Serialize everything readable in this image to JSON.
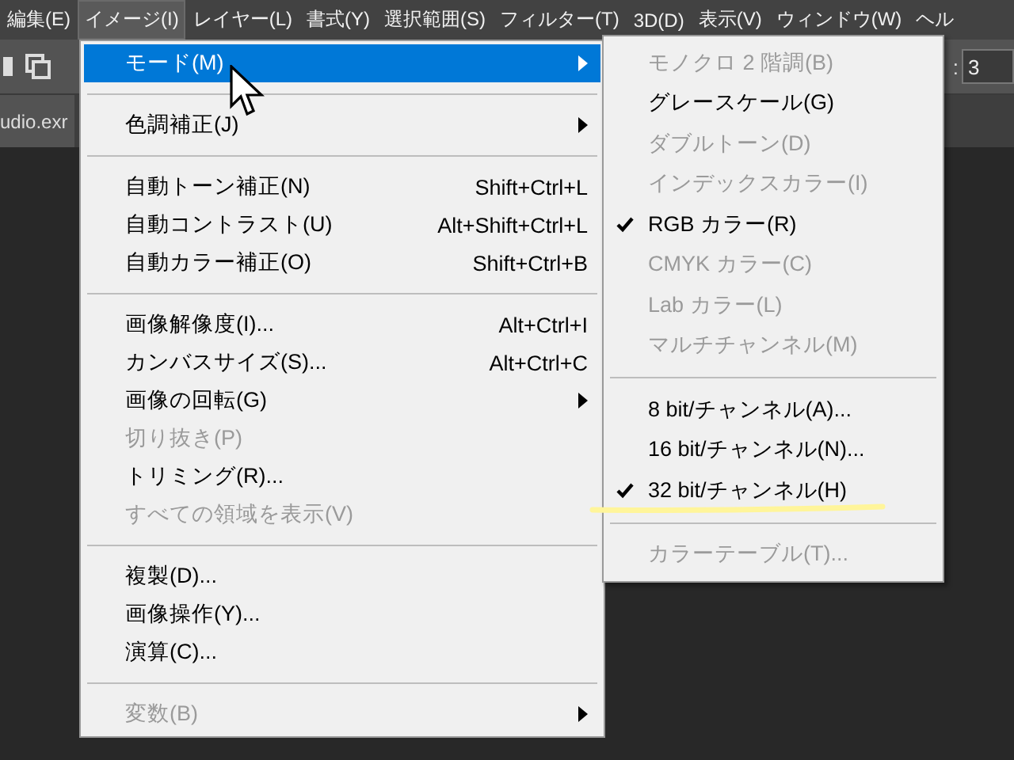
{
  "menubar": [
    {
      "label": "編集(E)",
      "selected": false
    },
    {
      "label": "イメージ(I)",
      "selected": true
    },
    {
      "label": "レイヤー(L)",
      "selected": false
    },
    {
      "label": "書式(Y)",
      "selected": false
    },
    {
      "label": "選択範囲(S)",
      "selected": false
    },
    {
      "label": "フィルター(T)",
      "selected": false
    },
    {
      "label": "3D(D)",
      "selected": false
    },
    {
      "label": "表示(V)",
      "selected": false
    },
    {
      "label": "ウィンドウ(W)",
      "selected": false
    },
    {
      "label": "ヘル",
      "selected": false
    }
  ],
  "toolbar": {
    "field_label": ":",
    "field_value": "3"
  },
  "document_tab": {
    "label": "udio.exr"
  },
  "image_menu": [
    {
      "kind": "item",
      "label": "モード(M)",
      "submenu": true,
      "disabled": false,
      "selected": true
    },
    {
      "kind": "separator"
    },
    {
      "kind": "item",
      "label": "色調補正(J)",
      "submenu": true,
      "disabled": false,
      "selected": false
    },
    {
      "kind": "separator"
    },
    {
      "kind": "item",
      "label": "自動トーン補正(N)",
      "shortcut": "Shift+Ctrl+L",
      "submenu": false,
      "disabled": false,
      "selected": false
    },
    {
      "kind": "item",
      "label": "自動コントラスト(U)",
      "shortcut": "Alt+Shift+Ctrl+L",
      "submenu": false,
      "disabled": false,
      "selected": false
    },
    {
      "kind": "item",
      "label": "自動カラー補正(O)",
      "shortcut": "Shift+Ctrl+B",
      "submenu": false,
      "disabled": false,
      "selected": false
    },
    {
      "kind": "separator"
    },
    {
      "kind": "item",
      "label": "画像解像度(I)...",
      "shortcut": "Alt+Ctrl+I",
      "submenu": false,
      "disabled": false,
      "selected": false
    },
    {
      "kind": "item",
      "label": "カンバスサイズ(S)...",
      "shortcut": "Alt+Ctrl+C",
      "submenu": false,
      "disabled": false,
      "selected": false
    },
    {
      "kind": "item",
      "label": "画像の回転(G)",
      "submenu": true,
      "disabled": false,
      "selected": false
    },
    {
      "kind": "item",
      "label": "切り抜き(P)",
      "submenu": false,
      "disabled": true,
      "selected": false
    },
    {
      "kind": "item",
      "label": "トリミング(R)...",
      "submenu": false,
      "disabled": false,
      "selected": false
    },
    {
      "kind": "item",
      "label": "すべての領域を表示(V)",
      "submenu": false,
      "disabled": true,
      "selected": false
    },
    {
      "kind": "separator"
    },
    {
      "kind": "item",
      "label": "複製(D)...",
      "submenu": false,
      "disabled": false,
      "selected": false
    },
    {
      "kind": "item",
      "label": "画像操作(Y)...",
      "submenu": false,
      "disabled": false,
      "selected": false
    },
    {
      "kind": "item",
      "label": "演算(C)...",
      "submenu": false,
      "disabled": false,
      "selected": false
    },
    {
      "kind": "separator"
    },
    {
      "kind": "item",
      "label": "変数(B)",
      "submenu": true,
      "disabled": true,
      "selected": false
    }
  ],
  "mode_submenu": [
    {
      "kind": "item",
      "label": "モノクロ 2 階調(B)",
      "checked": false,
      "disabled": true,
      "highlighted": false
    },
    {
      "kind": "item",
      "label": "グレースケール(G)",
      "checked": false,
      "disabled": false,
      "highlighted": false
    },
    {
      "kind": "item",
      "label": "ダブルトーン(D)",
      "checked": false,
      "disabled": true,
      "highlighted": false
    },
    {
      "kind": "item",
      "label": "インデックスカラー(I)",
      "checked": false,
      "disabled": true,
      "highlighted": false
    },
    {
      "kind": "item",
      "label": "RGB カラー(R)",
      "checked": true,
      "disabled": false,
      "highlighted": false
    },
    {
      "kind": "item",
      "label": "CMYK カラー(C)",
      "checked": false,
      "disabled": true,
      "highlighted": false
    },
    {
      "kind": "item",
      "label": "Lab カラー(L)",
      "checked": false,
      "disabled": true,
      "highlighted": false
    },
    {
      "kind": "item",
      "label": "マルチチャンネル(M)",
      "checked": false,
      "disabled": true,
      "highlighted": false
    },
    {
      "kind": "separator"
    },
    {
      "kind": "item",
      "label": "8 bit/チャンネル(A)...",
      "checked": false,
      "disabled": false,
      "highlighted": false
    },
    {
      "kind": "item",
      "label": "16 bit/チャンネル(N)...",
      "checked": false,
      "disabled": false,
      "highlighted": false
    },
    {
      "kind": "item",
      "label": "32 bit/チャンネル(H)",
      "checked": true,
      "disabled": false,
      "highlighted": true
    },
    {
      "kind": "separator"
    },
    {
      "kind": "item",
      "label": "カラーテーブル(T)...",
      "checked": false,
      "disabled": true,
      "highlighted": false
    }
  ]
}
